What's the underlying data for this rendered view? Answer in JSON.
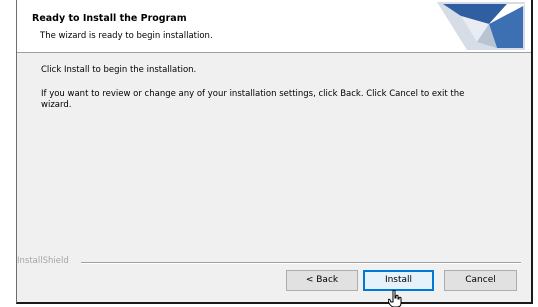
{
  "header": {
    "title": "Ready to Install the Program",
    "subtitle": "The wizard is ready to begin installation."
  },
  "body": {
    "line1": "Click Install to begin the installation.",
    "line2": "If you want to review or change any of your installation settings, click Back. Click Cancel to exit the wizard."
  },
  "footer": {
    "brand": "InstallShield"
  },
  "buttons": {
    "back": "< Back",
    "install": "Install",
    "cancel": "Cancel"
  },
  "colors": {
    "focus_border": "#0078d7",
    "logo_blue": "#2f5fa0",
    "panel": "#f0f0f0"
  },
  "icons": {
    "logo": "installshield-swirl-logo",
    "cursor": "hand-pointer-cursor"
  }
}
